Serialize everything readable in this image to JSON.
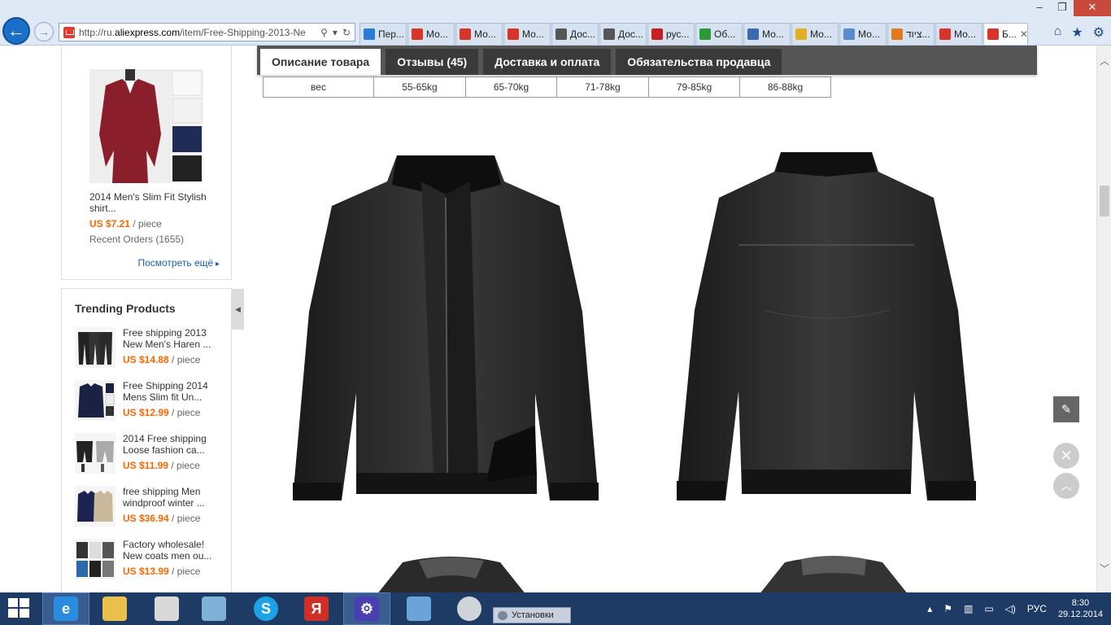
{
  "window": {
    "minimize": "–",
    "restore": "❐",
    "close": "✕"
  },
  "nav": {
    "back": "←",
    "forward": "→"
  },
  "address": {
    "prefix": "http://ru.",
    "domain": "aliexpress.com",
    "path": "/item/Free-Shipping-2013-Ne"
  },
  "tabs": [
    {
      "label": "Пер...",
      "color": "#2a7ad8"
    },
    {
      "label": "Мо...",
      "color": "#d8342a"
    },
    {
      "label": "Мо...",
      "color": "#d8342a"
    },
    {
      "label": "Мо...",
      "color": "#d8342a"
    },
    {
      "label": "Дос...",
      "color": "#555555"
    },
    {
      "label": "Дос...",
      "color": "#555555"
    },
    {
      "label": "рус...",
      "color": "#c81e1e"
    },
    {
      "label": "Об...",
      "color": "#2a9a3a"
    },
    {
      "label": "Мо...",
      "color": "#3a6ab0"
    },
    {
      "label": "Мо...",
      "color": "#e0b020"
    },
    {
      "label": "Мо...",
      "color": "#5a8ad0"
    },
    {
      "label": "ציוד...",
      "color": "#e07a20"
    },
    {
      "label": "Мо...",
      "color": "#d8342a"
    },
    {
      "label": "Б...",
      "color": "#d8342a",
      "active": true
    }
  ],
  "sidebar": {
    "recommended": {
      "title": "2014 Men's Slim Fit Stylish shirt...",
      "price": "US $7.21",
      "unit": " / piece",
      "orders": "Recent Orders (1655)",
      "more": "Посмотреть ещё"
    },
    "trending": {
      "heading": "Trending Products",
      "items": [
        {
          "name": "Free shipping 2013 New Men's Haren ...",
          "price": "US $14.88",
          "unit": " / piece"
        },
        {
          "name": "Free Shipping 2014 Mens Slim fit Un...",
          "price": "US $12.99",
          "unit": " / piece"
        },
        {
          "name": "2014 Free shipping Loose fashion ca...",
          "price": "US $11.99",
          "unit": " / piece"
        },
        {
          "name": "free shipping Men windproof winter ...",
          "price": "US $36.94",
          "unit": " / piece"
        },
        {
          "name": "Factory wholesale! New coats men ou...",
          "price": "US $13.99",
          "unit": " / piece"
        }
      ]
    }
  },
  "product_tabs": [
    {
      "label": "Описание товара",
      "active": true
    },
    {
      "label": "Отзывы (45)"
    },
    {
      "label": "Доставка и оплата"
    },
    {
      "label": "Обязательства продавца"
    }
  ],
  "size_table": {
    "row_label": "вес",
    "values": [
      "55-65kg",
      "65-70kg",
      "71-78kg",
      "79-85kg",
      "86-88kg"
    ]
  },
  "taskbar": {
    "window_label": "Установки",
    "lang": "РУС",
    "time": "8:30",
    "date": "29.12.2014"
  }
}
